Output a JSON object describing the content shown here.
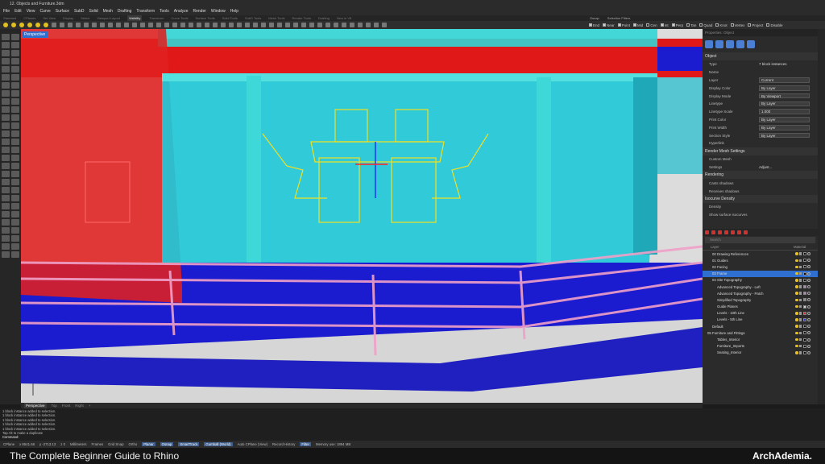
{
  "window": {
    "title": "12. Objects and Furniture.3dm"
  },
  "menu": [
    "File",
    "Edit",
    "View",
    "Curve",
    "Surface",
    "SubD",
    "Solid",
    "Mesh",
    "Drafting",
    "Transform",
    "Tools",
    "Analyze",
    "Render",
    "Window",
    "Help"
  ],
  "tabs": [
    "Standard",
    "CPlanes",
    "Set View",
    "Display",
    "Select",
    "Viewport Layout",
    "Visibility",
    "Transform",
    "Curve Tools",
    "Surface Tools",
    "Solid Tools",
    "SubD Tools",
    "Mesh Tools",
    "Render Tools",
    "Drafting",
    "New in V8"
  ],
  "active_tab": "Visibility",
  "osnap": {
    "tabs": [
      "Osnap",
      "Selection Filters"
    ],
    "items": [
      {
        "label": "End",
        "on": true
      },
      {
        "label": "Near",
        "on": true
      },
      {
        "label": "Point",
        "on": true
      },
      {
        "label": "Mid",
        "on": true
      },
      {
        "label": "Cen",
        "on": false
      },
      {
        "label": "Int",
        "on": true
      },
      {
        "label": "Perp",
        "on": true
      },
      {
        "label": "Tan",
        "on": false
      },
      {
        "label": "Quad",
        "on": false
      },
      {
        "label": "Knot",
        "on": false
      },
      {
        "label": "Vertex",
        "on": false
      },
      {
        "label": "Project",
        "on": false
      },
      {
        "label": "Disable",
        "on": false
      }
    ]
  },
  "viewport": {
    "label": "Perspective",
    "tabs": [
      "Perspective",
      "Top",
      "Front",
      "Right"
    ]
  },
  "properties": {
    "header": "Properties: Object",
    "section_object": "Object",
    "rows": [
      {
        "k": "Type",
        "v": "7 block instances"
      },
      {
        "k": "Name",
        "v": ""
      },
      {
        "k": "Layer",
        "v": "Current"
      },
      {
        "k": "Display Color",
        "v": "By Layer"
      },
      {
        "k": "Display Mode",
        "v": "By Viewport"
      },
      {
        "k": "Linetype",
        "v": "By Layer"
      },
      {
        "k": "Linetype Scale",
        "v": "1.000"
      },
      {
        "k": "Print Color",
        "v": "By Layer"
      },
      {
        "k": "Print Width",
        "v": "By Layer"
      },
      {
        "k": "Section Style",
        "v": "By Layer"
      },
      {
        "k": "Hyperlink",
        "v": ""
      }
    ],
    "section_mesh": "Render Mesh Settings",
    "mesh_rows": [
      {
        "k": "Custom Mesh",
        "v": ""
      },
      {
        "k": "Settings",
        "v": "Adjust..."
      }
    ],
    "section_rendering": "Rendering",
    "render_rows": [
      {
        "k": "Casts shadows",
        "v": ""
      },
      {
        "k": "Receives shadows",
        "v": ""
      }
    ],
    "section_isocurve": "Isocurve Density",
    "iso_rows": [
      {
        "k": "Density",
        "v": ""
      },
      {
        "k": "Show surface isocurves",
        "v": ""
      }
    ]
  },
  "layers": {
    "header": "Layers",
    "search_placeholder": "Search",
    "col_layer": "Layer",
    "col_material": "Material",
    "rows": [
      {
        "name": "00 Drawing References",
        "indent": 1,
        "color": "#000000",
        "sel": false
      },
      {
        "name": "01 Guides",
        "indent": 1,
        "color": "#000000",
        "sel": false
      },
      {
        "name": "02 Facing",
        "indent": 1,
        "color": "#000000",
        "sel": false
      },
      {
        "name": "03 Frame",
        "indent": 1,
        "color": "#000000",
        "sel": true
      },
      {
        "name": "04 Site Topography",
        "indent": 1,
        "color": "#000000",
        "sel": false
      },
      {
        "name": "Advanced Topography - Left",
        "indent": 2,
        "color": "#b77fc0",
        "sel": false
      },
      {
        "name": "Advanced Topography - Patch",
        "indent": 2,
        "color": "#b77fc0",
        "sel": false
      },
      {
        "name": "Simplified Topography",
        "indent": 2,
        "color": "#888888",
        "sel": false
      },
      {
        "name": "Guide Planes",
        "indent": 2,
        "color": "#cccccc",
        "sel": false
      },
      {
        "name": "Levels - 10th Line",
        "indent": 2,
        "color": "#dd2222",
        "sel": false
      },
      {
        "name": "Levels - 5th Line",
        "indent": 2,
        "color": "#2233dd",
        "sel": false
      },
      {
        "name": "Default",
        "indent": 1,
        "color": "#000000",
        "sel": false
      },
      {
        "name": "05 Furniture and Fittings",
        "indent": 0,
        "color": "#000000",
        "sel": false
      },
      {
        "name": "Tables_Interior",
        "indent": 2,
        "color": "#000000",
        "sel": false
      },
      {
        "name": "Furniture_Imports",
        "indent": 2,
        "color": "#000000",
        "sel": false
      },
      {
        "name": "Seating_Interior",
        "indent": 2,
        "color": "#000000",
        "sel": false
      }
    ]
  },
  "command_history": [
    "1 block instance added to selection.",
    "1 block instance added to selection.",
    "1 block instance added to selection.",
    "1 block instance added to selection.",
    "1 block instance added to selection.",
    "Tap Alt to make a duplicate"
  ],
  "command_prompt": "Command:",
  "status": {
    "cplane": "CPlane",
    "x": "x 8541.68",
    "y": "y -2713.13",
    "z": "z 0",
    "units": "Millimeters",
    "layer": "Frames",
    "items": [
      "Grid Snap",
      "Ortho",
      "Planar",
      "Osnap",
      "SmartTrack",
      "Gumball (World)",
      "Auto CPlane (View)",
      "Record History",
      "Filter"
    ],
    "highlighted": [
      "Planar",
      "Osnap",
      "SmartTrack",
      "Gumball (World)",
      "Filter"
    ],
    "memory": "Memory use: 1894 MB"
  },
  "banner": {
    "title": "The Complete Beginner Guide to Rhino",
    "brand": "ArchAdemia."
  }
}
